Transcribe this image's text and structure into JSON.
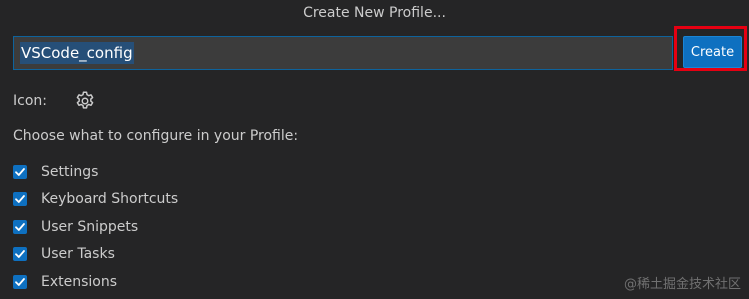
{
  "dialog": {
    "title": "Create New Profile..."
  },
  "name_input": {
    "value": "VSCode_config"
  },
  "create_button": {
    "label": "Create"
  },
  "icon_row": {
    "label": "Icon:",
    "icon": "gear-icon"
  },
  "configure": {
    "heading": "Choose what to configure in your Profile:",
    "options": [
      {
        "label": "Settings",
        "checked": true
      },
      {
        "label": "Keyboard Shortcuts",
        "checked": true
      },
      {
        "label": "User Snippets",
        "checked": true
      },
      {
        "label": "User Tasks",
        "checked": true
      },
      {
        "label": "Extensions",
        "checked": true
      }
    ]
  },
  "watermark": "@稀土掘金技术社区",
  "colors": {
    "accent": "#0e70c0",
    "background": "#252526",
    "highlight": "#e60012",
    "selection": "#264f78"
  }
}
